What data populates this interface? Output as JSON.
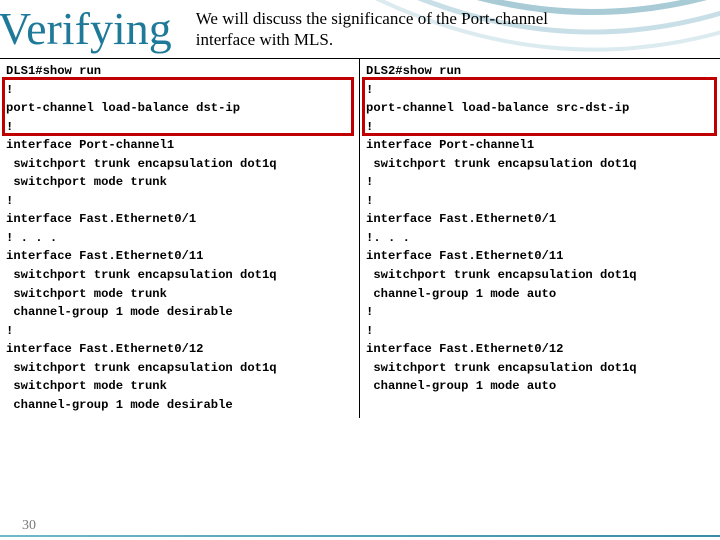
{
  "header": {
    "title": "Verifying",
    "subtitle_line1": "We will discuss the significance of the Port-channel",
    "subtitle_line2": "interface with MLS."
  },
  "column_left": {
    "lines": [
      "DLS1#show run",
      "!",
      "port-channel load-balance dst-ip",
      "!",
      "interface Port-channel1",
      " switchport trunk encapsulation dot1q",
      " switchport mode trunk",
      "!",
      "interface Fast.Ethernet0/1",
      "! . . .",
      "interface Fast.Ethernet0/11",
      " switchport trunk encapsulation dot1q",
      " switchport mode trunk",
      " channel-group 1 mode desirable",
      "!",
      "interface Fast.Ethernet0/12",
      " switchport trunk encapsulation dot1q",
      " switchport mode trunk",
      " channel-group 1 mode desirable"
    ]
  },
  "column_right": {
    "lines": [
      "DLS2#show run",
      "!",
      "port-channel load-balance src-dst-ip",
      "!",
      "interface Port-channel1",
      " switchport trunk encapsulation dot1q",
      "!",
      "!",
      "interface Fast.Ethernet0/1",
      "!. . .",
      "interface Fast.Ethernet0/11",
      " switchport trunk encapsulation dot1q",
      " channel-group 1 mode auto",
      "!",
      "!",
      "interface Fast.Ethernet0/12",
      " switchport trunk encapsulation dot1q",
      " channel-group 1 mode auto"
    ]
  },
  "page_number": "30"
}
